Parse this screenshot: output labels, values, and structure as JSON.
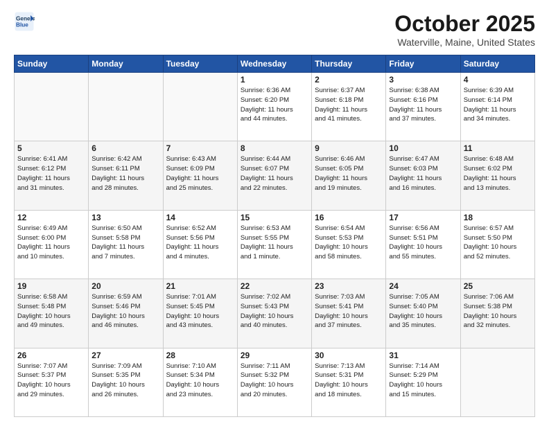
{
  "header": {
    "logo_line1": "General",
    "logo_line2": "Blue",
    "title": "October 2025",
    "subtitle": "Waterville, Maine, United States"
  },
  "weekdays": [
    "Sunday",
    "Monday",
    "Tuesday",
    "Wednesday",
    "Thursday",
    "Friday",
    "Saturday"
  ],
  "weeks": [
    [
      {
        "day": "",
        "info": ""
      },
      {
        "day": "",
        "info": ""
      },
      {
        "day": "",
        "info": ""
      },
      {
        "day": "1",
        "info": "Sunrise: 6:36 AM\nSunset: 6:20 PM\nDaylight: 11 hours\nand 44 minutes."
      },
      {
        "day": "2",
        "info": "Sunrise: 6:37 AM\nSunset: 6:18 PM\nDaylight: 11 hours\nand 41 minutes."
      },
      {
        "day": "3",
        "info": "Sunrise: 6:38 AM\nSunset: 6:16 PM\nDaylight: 11 hours\nand 37 minutes."
      },
      {
        "day": "4",
        "info": "Sunrise: 6:39 AM\nSunset: 6:14 PM\nDaylight: 11 hours\nand 34 minutes."
      }
    ],
    [
      {
        "day": "5",
        "info": "Sunrise: 6:41 AM\nSunset: 6:12 PM\nDaylight: 11 hours\nand 31 minutes."
      },
      {
        "day": "6",
        "info": "Sunrise: 6:42 AM\nSunset: 6:11 PM\nDaylight: 11 hours\nand 28 minutes."
      },
      {
        "day": "7",
        "info": "Sunrise: 6:43 AM\nSunset: 6:09 PM\nDaylight: 11 hours\nand 25 minutes."
      },
      {
        "day": "8",
        "info": "Sunrise: 6:44 AM\nSunset: 6:07 PM\nDaylight: 11 hours\nand 22 minutes."
      },
      {
        "day": "9",
        "info": "Sunrise: 6:46 AM\nSunset: 6:05 PM\nDaylight: 11 hours\nand 19 minutes."
      },
      {
        "day": "10",
        "info": "Sunrise: 6:47 AM\nSunset: 6:03 PM\nDaylight: 11 hours\nand 16 minutes."
      },
      {
        "day": "11",
        "info": "Sunrise: 6:48 AM\nSunset: 6:02 PM\nDaylight: 11 hours\nand 13 minutes."
      }
    ],
    [
      {
        "day": "12",
        "info": "Sunrise: 6:49 AM\nSunset: 6:00 PM\nDaylight: 11 hours\nand 10 minutes."
      },
      {
        "day": "13",
        "info": "Sunrise: 6:50 AM\nSunset: 5:58 PM\nDaylight: 11 hours\nand 7 minutes."
      },
      {
        "day": "14",
        "info": "Sunrise: 6:52 AM\nSunset: 5:56 PM\nDaylight: 11 hours\nand 4 minutes."
      },
      {
        "day": "15",
        "info": "Sunrise: 6:53 AM\nSunset: 5:55 PM\nDaylight: 11 hours\nand 1 minute."
      },
      {
        "day": "16",
        "info": "Sunrise: 6:54 AM\nSunset: 5:53 PM\nDaylight: 10 hours\nand 58 minutes."
      },
      {
        "day": "17",
        "info": "Sunrise: 6:56 AM\nSunset: 5:51 PM\nDaylight: 10 hours\nand 55 minutes."
      },
      {
        "day": "18",
        "info": "Sunrise: 6:57 AM\nSunset: 5:50 PM\nDaylight: 10 hours\nand 52 minutes."
      }
    ],
    [
      {
        "day": "19",
        "info": "Sunrise: 6:58 AM\nSunset: 5:48 PM\nDaylight: 10 hours\nand 49 minutes."
      },
      {
        "day": "20",
        "info": "Sunrise: 6:59 AM\nSunset: 5:46 PM\nDaylight: 10 hours\nand 46 minutes."
      },
      {
        "day": "21",
        "info": "Sunrise: 7:01 AM\nSunset: 5:45 PM\nDaylight: 10 hours\nand 43 minutes."
      },
      {
        "day": "22",
        "info": "Sunrise: 7:02 AM\nSunset: 5:43 PM\nDaylight: 10 hours\nand 40 minutes."
      },
      {
        "day": "23",
        "info": "Sunrise: 7:03 AM\nSunset: 5:41 PM\nDaylight: 10 hours\nand 37 minutes."
      },
      {
        "day": "24",
        "info": "Sunrise: 7:05 AM\nSunset: 5:40 PM\nDaylight: 10 hours\nand 35 minutes."
      },
      {
        "day": "25",
        "info": "Sunrise: 7:06 AM\nSunset: 5:38 PM\nDaylight: 10 hours\nand 32 minutes."
      }
    ],
    [
      {
        "day": "26",
        "info": "Sunrise: 7:07 AM\nSunset: 5:37 PM\nDaylight: 10 hours\nand 29 minutes."
      },
      {
        "day": "27",
        "info": "Sunrise: 7:09 AM\nSunset: 5:35 PM\nDaylight: 10 hours\nand 26 minutes."
      },
      {
        "day": "28",
        "info": "Sunrise: 7:10 AM\nSunset: 5:34 PM\nDaylight: 10 hours\nand 23 minutes."
      },
      {
        "day": "29",
        "info": "Sunrise: 7:11 AM\nSunset: 5:32 PM\nDaylight: 10 hours\nand 20 minutes."
      },
      {
        "day": "30",
        "info": "Sunrise: 7:13 AM\nSunset: 5:31 PM\nDaylight: 10 hours\nand 18 minutes."
      },
      {
        "day": "31",
        "info": "Sunrise: 7:14 AM\nSunset: 5:29 PM\nDaylight: 10 hours\nand 15 minutes."
      },
      {
        "day": "",
        "info": ""
      }
    ]
  ]
}
